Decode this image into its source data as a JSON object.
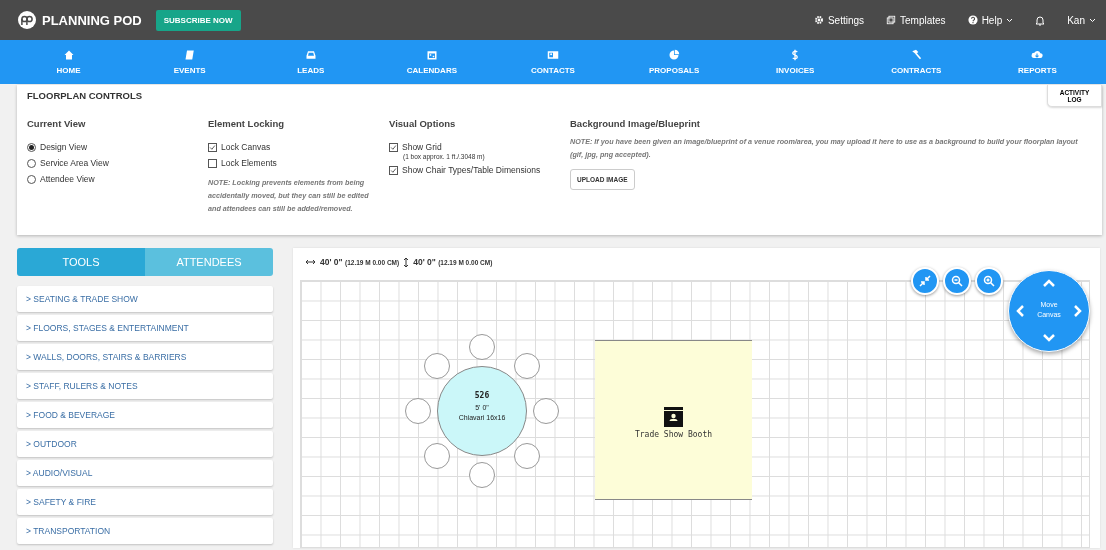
{
  "header": {
    "brand": "PLANNING POD",
    "subscribe": "SUBSCRIBE NOW",
    "links": [
      {
        "label": "Settings",
        "caret": false
      },
      {
        "label": "Templates",
        "caret": false
      },
      {
        "label": "Help",
        "caret": true
      }
    ],
    "user": "Kan"
  },
  "nav": [
    {
      "label": "HOME"
    },
    {
      "label": "EVENTS"
    },
    {
      "label": "LEADS"
    },
    {
      "label": "CALENDARS"
    },
    {
      "label": "CONTACTS"
    },
    {
      "label": "PROPOSALS"
    },
    {
      "label": "INVOICES"
    },
    {
      "label": "CONTRACTS"
    },
    {
      "label": "REPORTS"
    }
  ],
  "controls": {
    "title": "FLOORPLAN CONTROLS",
    "activity_log": "ACTIVITY LOG",
    "current_view": {
      "heading": "Current View",
      "options": [
        {
          "label": "Design View",
          "selected": true
        },
        {
          "label": "Service Area View",
          "selected": false
        },
        {
          "label": "Attendee View",
          "selected": false
        }
      ]
    },
    "element_locking": {
      "heading": "Element Locking",
      "options": [
        {
          "label": "Lock Canvas",
          "checked": true
        },
        {
          "label": "Lock Elements",
          "checked": false
        }
      ],
      "note": "NOTE: Locking prevents elements from being accidentally moved, but they can still be edited and attendees can still be added/removed."
    },
    "visual_options": {
      "heading": "Visual Options",
      "options": [
        {
          "label": "Show Grid",
          "checked": true,
          "hint": "(1 box approx. 1 ft./.3048 m)"
        },
        {
          "label": "Show Chair Types/Table Dimensions",
          "checked": true
        }
      ]
    },
    "background": {
      "heading": "Background Image/Blueprint",
      "note": "NOTE: If you have been given an image/blueprint of a venue room/area, you may upload it here to use as a background to build your floorplan layout (gif, jpg, png accepted).",
      "button": "UPLOAD IMAGE"
    }
  },
  "sidebar": {
    "tabs": [
      {
        "label": "TOOLS",
        "selected": true
      },
      {
        "label": "ATTENDEES",
        "selected": false
      }
    ],
    "items": [
      "> SEATING & TRADE SHOW",
      "> FLOORS, STAGES & ENTERTAINMENT",
      "> WALLS, DOORS, STAIRS & BARRIERS",
      "> STAFF, RULERS & NOTES",
      "> FOOD & BEVERAGE",
      "> OUTDOOR",
      "> AUDIO/VISUAL",
      "> SAFETY & FIRE",
      "> TRANSPORTATION"
    ]
  },
  "canvas": {
    "width": "40' 0\"",
    "width_metric": "(12.19 M 0.00 CM)",
    "height": "40' 0\"",
    "height_metric": "(12.19 M 0.00 CM)",
    "move_label": "Move Canvas",
    "elements": [
      {
        "kind": "round_table",
        "number": "526",
        "size": "5' 0\"",
        "chairs": "Chiavari 16x16"
      },
      {
        "kind": "booth",
        "label": "Trade Show Booth"
      }
    ]
  }
}
